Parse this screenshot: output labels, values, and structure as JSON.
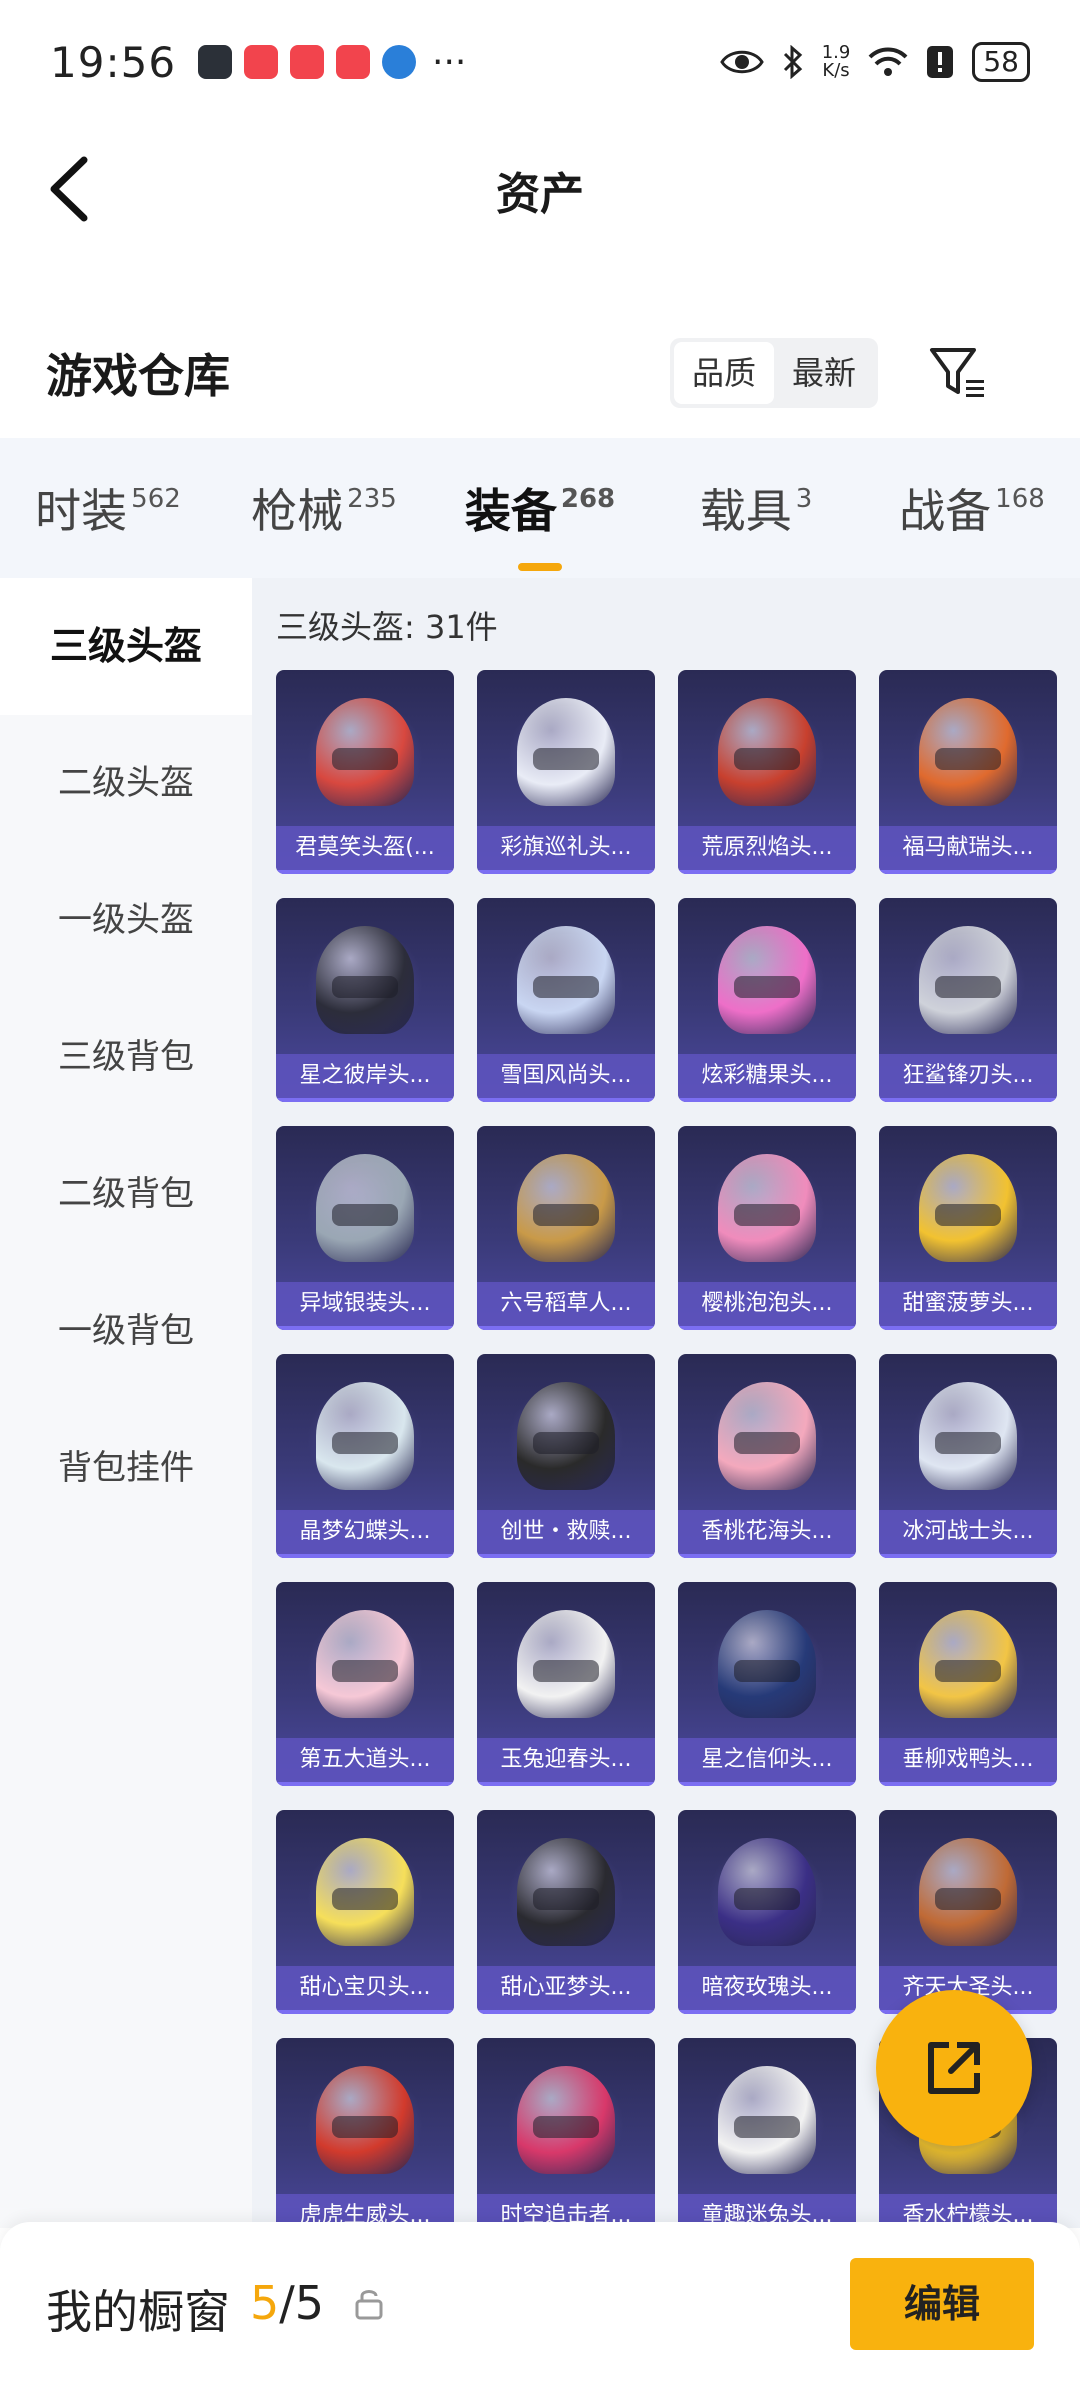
{
  "status_bar": {
    "time": "19:56",
    "dots": "···",
    "speed_value": "1.9",
    "speed_unit": "K/s",
    "battery": "58"
  },
  "header": {
    "title": "资产"
  },
  "warehouse": {
    "title": "游戏仓库",
    "sort_quality": "品质",
    "sort_latest": "最新"
  },
  "tabs": [
    {
      "label": "时装",
      "count": "562"
    },
    {
      "label": "枪械",
      "count": "235"
    },
    {
      "label": "装备",
      "count": "268"
    },
    {
      "label": "载具",
      "count": "3"
    },
    {
      "label": "战备",
      "count": "168"
    }
  ],
  "sidebar": {
    "items": [
      "三级头盔",
      "二级头盔",
      "一级头盔",
      "三级背包",
      "二级背包",
      "一级背包",
      "背包挂件"
    ]
  },
  "content": {
    "count_text": "三级头盔: 31件"
  },
  "items": [
    {
      "name": "君莫笑头盔(...",
      "color": "#d8483f"
    },
    {
      "name": "彩旗巡礼头...",
      "color": "#e9ecf6"
    },
    {
      "name": "荒原烈焰头...",
      "color": "#c8402e"
    },
    {
      "name": "福马献瑞头...",
      "color": "#e06a2e"
    },
    {
      "name": "星之彼岸头...",
      "color": "#2c2d3a"
    },
    {
      "name": "雪国风尚头...",
      "color": "#c9d6f2"
    },
    {
      "name": "炫彩糖果头...",
      "color": "#ee6fc8"
    },
    {
      "name": "狂鲨锋刃头...",
      "color": "#cfd2da"
    },
    {
      "name": "异域银装头...",
      "color": "#9aa7b4"
    },
    {
      "name": "六号稻草人...",
      "color": "#c99a48"
    },
    {
      "name": "樱桃泡泡头...",
      "color": "#f08cbc"
    },
    {
      "name": "甜蜜菠萝头...",
      "color": "#f2c230"
    },
    {
      "name": "晶梦幻蝶头...",
      "color": "#d9e7ee"
    },
    {
      "name": "创世・救赎...",
      "color": "#2a2a2a"
    },
    {
      "name": "香桃花海头...",
      "color": "#f4a9bd"
    },
    {
      "name": "冰河战士头...",
      "color": "#dfe6f2"
    },
    {
      "name": "第五大道头...",
      "color": "#f6c8d6"
    },
    {
      "name": "玉兔迎春头...",
      "color": "#f2f2f2"
    },
    {
      "name": "星之信仰头...",
      "color": "#263a78"
    },
    {
      "name": "垂柳戏鸭头...",
      "color": "#f2c545"
    },
    {
      "name": "甜心宝贝头...",
      "color": "#f6df5a"
    },
    {
      "name": "甜心亚梦头...",
      "color": "#2a2a30"
    },
    {
      "name": "暗夜玫瑰头...",
      "color": "#3b2f86"
    },
    {
      "name": "齐天大圣头...",
      "color": "#c06a35"
    },
    {
      "name": "虎虎生威头...",
      "color": "#d23a2c"
    },
    {
      "name": "时空追击者...",
      "color": "#d8386a"
    },
    {
      "name": "童趣迷兔头...",
      "color": "#f2f2f2"
    },
    {
      "name": "香水柠檬头...",
      "color": "#f0c330"
    }
  ],
  "bottom": {
    "title": "我的橱窗",
    "current": "5",
    "separator": "/",
    "total": "5",
    "edit": "编辑"
  },
  "colors": {
    "accent": "#f9b20e",
    "tab_indicator": "#f5a70c",
    "card_bg": "#3a3a78"
  }
}
